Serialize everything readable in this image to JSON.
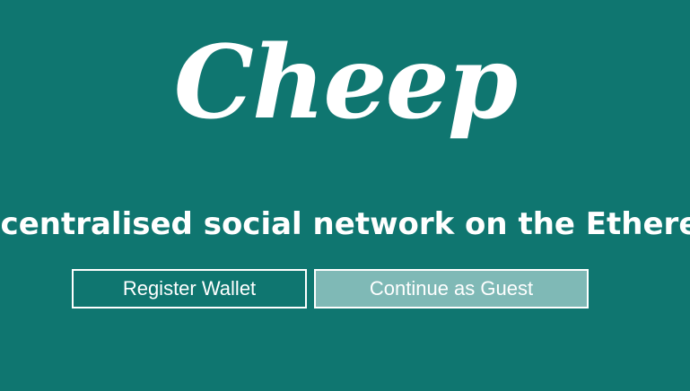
{
  "brand": {
    "logo_text": "Cheep"
  },
  "hero": {
    "tagline": "A decentralised social network on the Ethereum blockchain"
  },
  "actions": {
    "register_label": "Register Wallet",
    "guest_label": "Continue as Guest"
  },
  "colors": {
    "background": "#0f7670",
    "text": "#ffffff",
    "guest_button_bg": "#7fb9b6"
  }
}
